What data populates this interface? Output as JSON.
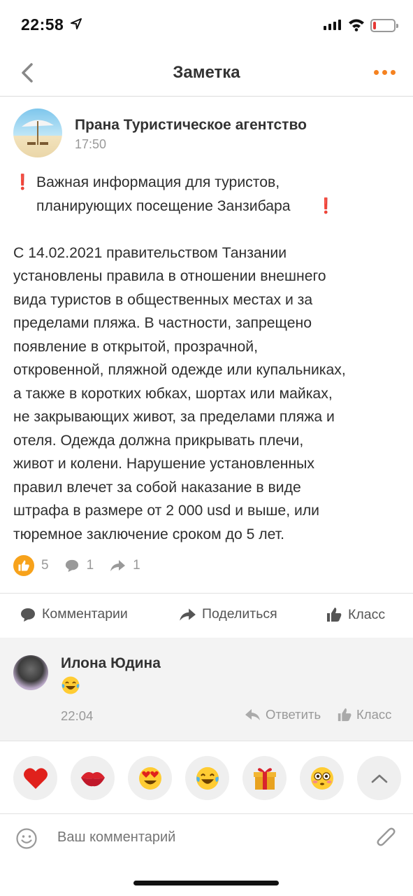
{
  "status_bar": {
    "time": "22:58",
    "battery_level": 0.15
  },
  "nav": {
    "title": "Заметка"
  },
  "post": {
    "author": "Прана Туристическое агентство",
    "time": "17:50",
    "headline_mark": "❗",
    "headline": "Важная информация для туристов,\nпланирующих посещение Занзибара",
    "body": "С 14.02.2021 правительством Танзании\nустановлены правила в отношении внешнего\nвида туристов в общественных местах и за\nпределами пляжа. В частности, запрещено\nпоявление в открытой, прозрачной,\nоткровенной, пляжной одежде или купальниках,\nа также в коротких юбках, шортах или майках,\nне закрывающих живот, за пределами пляжа и\nотеля. Одежда должна прикрывать плечи,\nживот и колени. Нарушение установленных\nправил влечет за собой наказание в виде\nштрафа в размере от 2 000 usd и выше, или\nтюремное заключение сроком до 5 лет."
  },
  "stats": {
    "likes": "5",
    "comments": "1",
    "shares": "1"
  },
  "actions": {
    "comments": "Комментарии",
    "share": "Поделиться",
    "klass": "Класс"
  },
  "comment": {
    "author": "Илона Юдина",
    "emoji": "😂",
    "time": "22:04",
    "reply": "Ответить",
    "klass": "Класс"
  },
  "reactions": [
    "❤️",
    "💋",
    "😍",
    "😂",
    "🎁",
    "😳"
  ],
  "input": {
    "placeholder": "Ваш комментарий"
  },
  "colors": {
    "accent": "#f58220",
    "like": "#f7a21b",
    "text_muted": "#999999"
  }
}
